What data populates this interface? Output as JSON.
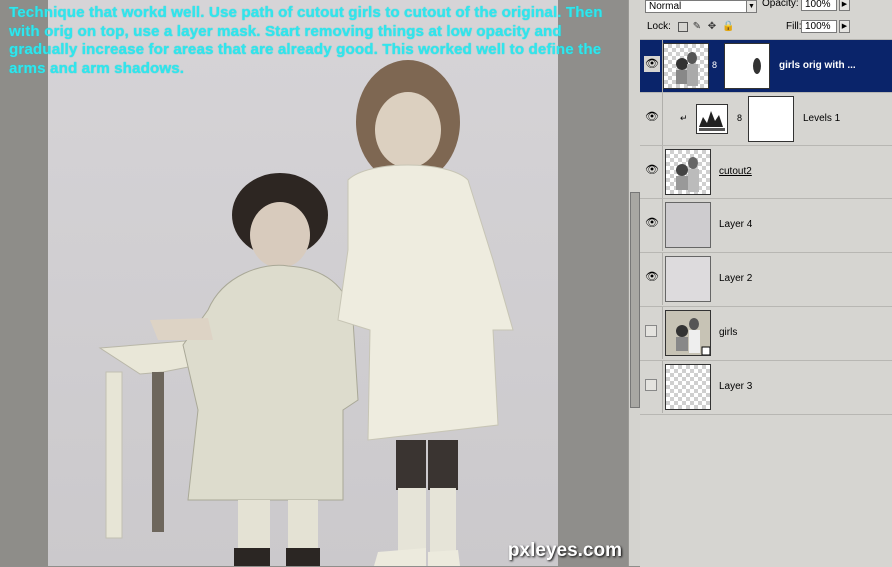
{
  "caption": "Technique that workd well. Use path of cutout girls to cutout of the original. Then with orig on top, use a layer mask. Start removing things at low opacity and gradually increase for areas that are already good. This worked well to define the arms and arm shadows.",
  "watermark": "pxleyes.com",
  "panel": {
    "blend_mode": "Normal",
    "opacity_label": "Opacity:",
    "opacity_value": "100%",
    "lock_label": "Lock:",
    "fill_label": "Fill:",
    "fill_value": "100%",
    "layers": [
      {
        "name": "girls orig with ...",
        "visible": true,
        "selected": true
      },
      {
        "name": "Levels 1",
        "visible": true,
        "selected": false
      },
      {
        "name": "cutout2",
        "visible": true,
        "selected": false
      },
      {
        "name": "Layer 4",
        "visible": true,
        "selected": false
      },
      {
        "name": "Layer 2",
        "visible": true,
        "selected": false
      },
      {
        "name": "girls",
        "visible": false,
        "selected": false
      },
      {
        "name": "Layer 3",
        "visible": false,
        "selected": false
      }
    ]
  },
  "colors": {
    "caption": "#2fe6ee",
    "selection": "#0a246a",
    "panel": "#d6d5d1"
  }
}
